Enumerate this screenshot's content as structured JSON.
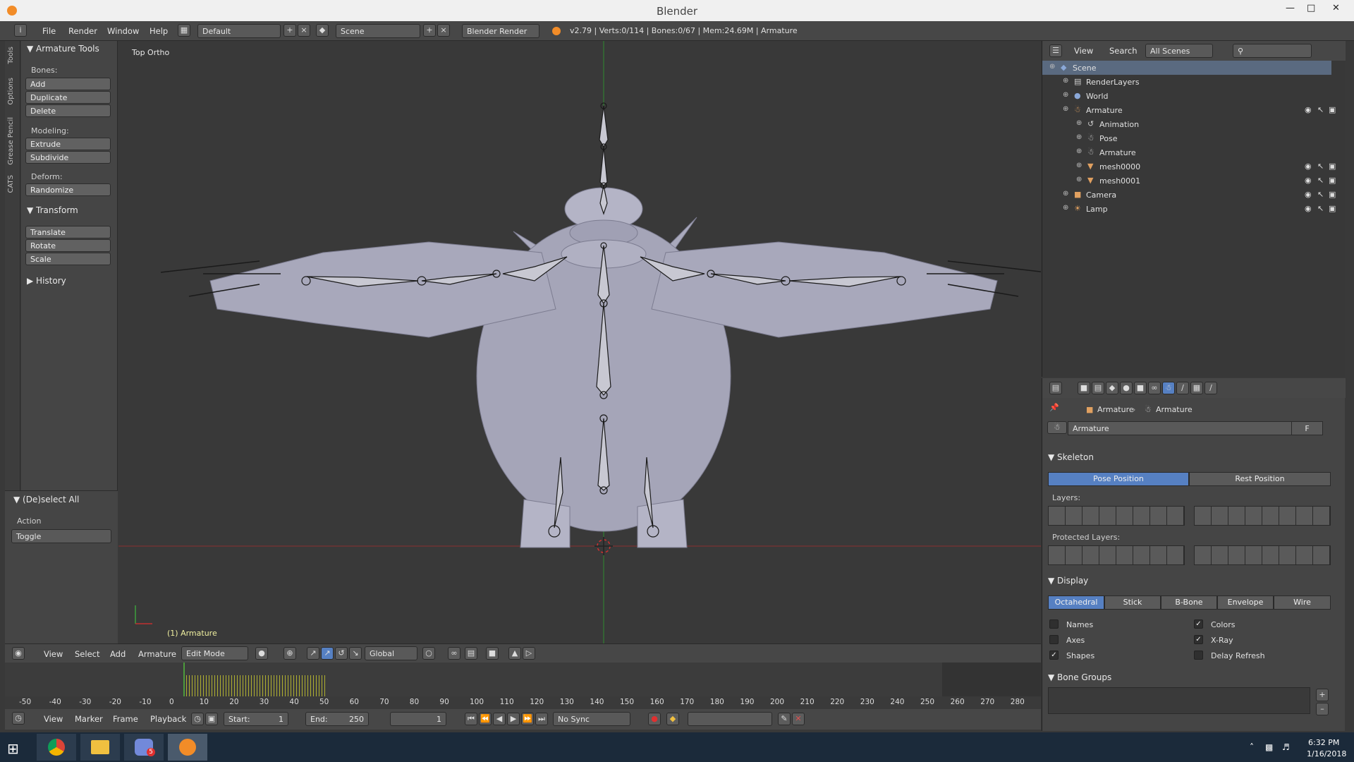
{
  "window": {
    "title": "Blender"
  },
  "menu": {
    "file": "File",
    "render": "Render",
    "window": "Window",
    "help": "Help",
    "layout": "Default",
    "scene": "Scene",
    "engine": "Blender Render",
    "stats": "v2.79 | Verts:0/114 | Bones:0/67 | Mem:24.69M | Armature"
  },
  "lefttabs": {
    "tools": "Tools",
    "options": "Options",
    "grease": "Grease Pencil",
    "cats": "CATS"
  },
  "toolshelf": {
    "panel": "Armature Tools",
    "bones_label": "Bones:",
    "add": "Add",
    "duplicate": "Duplicate",
    "delete": "Delete",
    "modeling_label": "Modeling:",
    "extrude": "Extrude",
    "subdivide": "Subdivide",
    "deform_label": "Deform:",
    "randomize": "Randomize",
    "transform": "Transform",
    "translate": "Translate",
    "rotate": "Rotate",
    "scale": "Scale",
    "history": "History",
    "operator": "(De)select All",
    "action_label": "Action",
    "action_value": "Toggle"
  },
  "viewport": {
    "view_name": "Top Ortho",
    "object_label": "(1) Armature"
  },
  "vpheader": {
    "view": "View",
    "select": "Select",
    "add": "Add",
    "armature": "Armature",
    "mode": "Edit Mode",
    "orientation": "Global"
  },
  "timeline": {
    "ticks": [
      "-50",
      "-40",
      "-30",
      "-20",
      "-10",
      "0",
      "10",
      "20",
      "30",
      "40",
      "50",
      "60",
      "70",
      "80",
      "90",
      "100",
      "110",
      "120",
      "130",
      "140",
      "150",
      "160",
      "170",
      "180",
      "190",
      "200",
      "210",
      "220",
      "230",
      "240",
      "250",
      "260",
      "270",
      "280"
    ]
  },
  "tlbar": {
    "view": "View",
    "marker": "Marker",
    "frame": "Frame",
    "playback": "Playback",
    "start_label": "Start:",
    "start_value": "1",
    "end_label": "End:",
    "end_value": "250",
    "current": "1",
    "sync": "No Sync"
  },
  "outliner": {
    "view": "View",
    "search": "Search",
    "filter": "All Scenes",
    "rows": [
      {
        "label": "Scene",
        "indent": 0
      },
      {
        "label": "RenderLayers",
        "indent": 1
      },
      {
        "label": "World",
        "indent": 1
      },
      {
        "label": "Armature",
        "indent": 1
      },
      {
        "label": "Animation",
        "indent": 2
      },
      {
        "label": "Pose",
        "indent": 2
      },
      {
        "label": "Armature",
        "indent": 2
      },
      {
        "label": "mesh0000",
        "indent": 2
      },
      {
        "label": "mesh0001",
        "indent": 2
      },
      {
        "label": "Camera",
        "indent": 1
      },
      {
        "label": "Lamp",
        "indent": 1
      }
    ]
  },
  "properties": {
    "breadcrumb_obj": "Armature",
    "breadcrumb_data": "Armature",
    "name_field": "Armature",
    "fake_user": "F",
    "skeleton": "Skeleton",
    "pose_position": "Pose Position",
    "rest_position": "Rest Position",
    "layers": "Layers:",
    "protected_layers": "Protected Layers:",
    "display": "Display",
    "octahedral": "Octahedral",
    "stick": "Stick",
    "bbone": "B-Bone",
    "envelope": "Envelope",
    "wire": "Wire",
    "names": "Names",
    "axes": "Axes",
    "shapes": "Shapes",
    "colors": "Colors",
    "xray": "X-Ray",
    "delay_refresh": "Delay Refresh",
    "bone_groups": "Bone Groups"
  },
  "taskbar": {
    "time": "6:32 PM",
    "date": "1/16/2018",
    "discord_badge": "5"
  },
  "colors": {
    "accent": "#5680c2",
    "selected_row": "#5a6a80",
    "bg": "#393939"
  }
}
